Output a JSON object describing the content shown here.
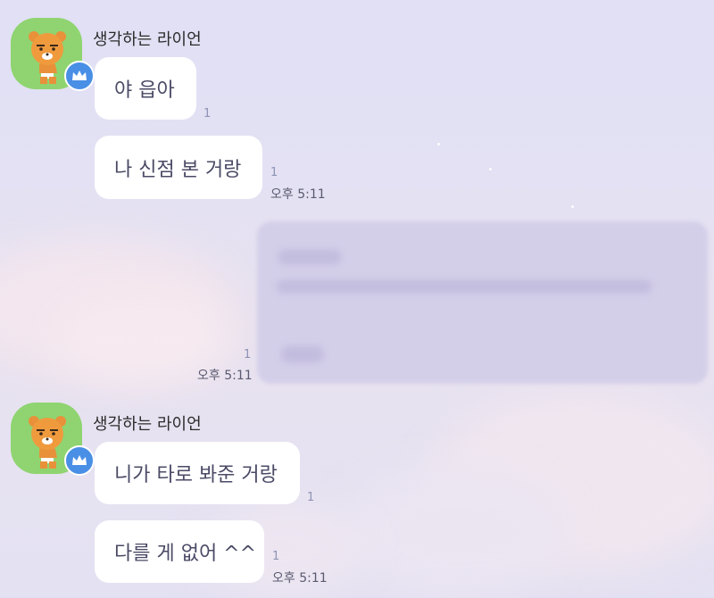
{
  "chat": {
    "groups": [
      {
        "sender": "생각하는 라이언",
        "messages": [
          {
            "text": "야 읍아",
            "unread": "1"
          },
          {
            "text": "나 신점 본 거랑",
            "unread": "1",
            "time": "오후 5:11"
          }
        ]
      },
      {
        "sender": "",
        "messages": [
          {
            "text": "",
            "unread": "1",
            "time": "오후 5:11",
            "blurred": true
          }
        ]
      },
      {
        "sender": "생각하는 라이언",
        "messages": [
          {
            "text": "니가 타로 봐준 거랑",
            "unread": "1"
          },
          {
            "text": "다를 게 없어 ^^",
            "unread": "1",
            "time": "오후 5:11"
          }
        ]
      }
    ]
  },
  "colors": {
    "background": "#e3e1f3",
    "bubble": "#ffffff",
    "avatar_bg": "#8fd470",
    "badge": "#4a8fe6",
    "text": "#4a4a66"
  },
  "icons": {
    "avatar": "ryan-lion-avatar",
    "badge": "crown-badge-icon"
  }
}
